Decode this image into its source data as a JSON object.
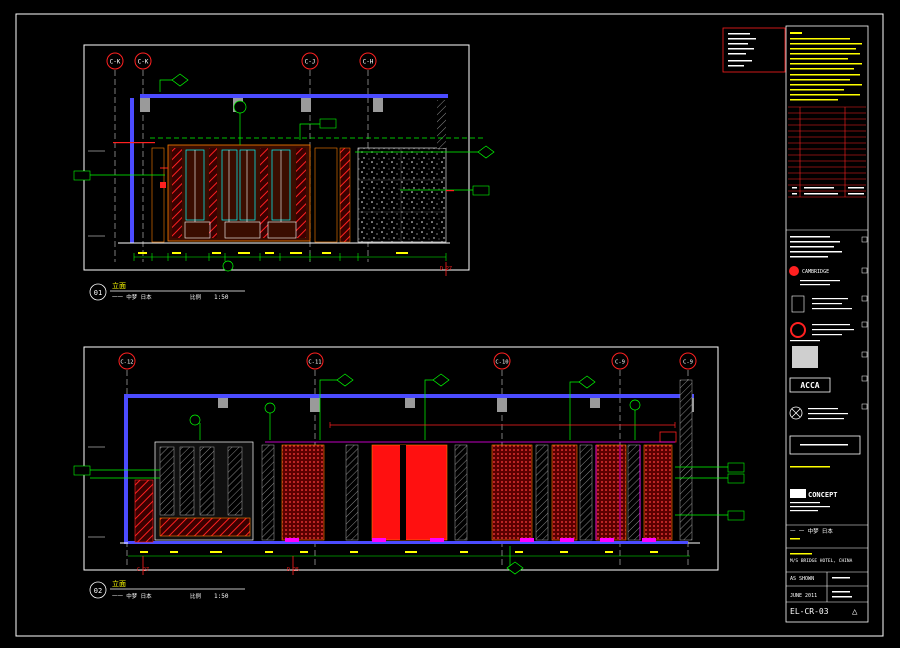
{
  "drawing": {
    "views": [
      {
        "number": "01",
        "title": "立面",
        "subtitle": "一一 中梦 日本",
        "scale_label": "比例",
        "scale": "1:50",
        "grid_labels": [
          "C-K",
          "C-K",
          "C-J",
          "C-H"
        ],
        "base_marker": "D 27"
      },
      {
        "number": "02",
        "title": "立面",
        "subtitle": "一一 中梦 日本",
        "scale_label": "比例",
        "scale": "1:50",
        "grid_labels": [
          "C-12",
          "C-11",
          "C-10",
          "C-9",
          "C-9"
        ],
        "base_markers": [
          "C 27",
          "D 25"
        ]
      }
    ]
  },
  "title_block": {
    "consultant": "CAMBRIDGE",
    "logo_text": "ACCA",
    "concept_logo": "CONCEPT",
    "drawing_name": "一 一 中梦 日本",
    "project": "M/S BRIDGE HOTEL, CHINA",
    "scale": "AS SHOWN",
    "date": "JUNE 2011",
    "drawing_no": "EL-CR-03",
    "revision_symbol": "△"
  },
  "colors": {
    "background": "#000000",
    "frame": "#ffffff",
    "ceiling": "#4b4bff",
    "dimension": "#00ff00",
    "red": "#ff0000",
    "yellow": "#ffff00",
    "cyan": "#00ffff",
    "magenta": "#ff00ff",
    "orange": "#ff7f00"
  }
}
